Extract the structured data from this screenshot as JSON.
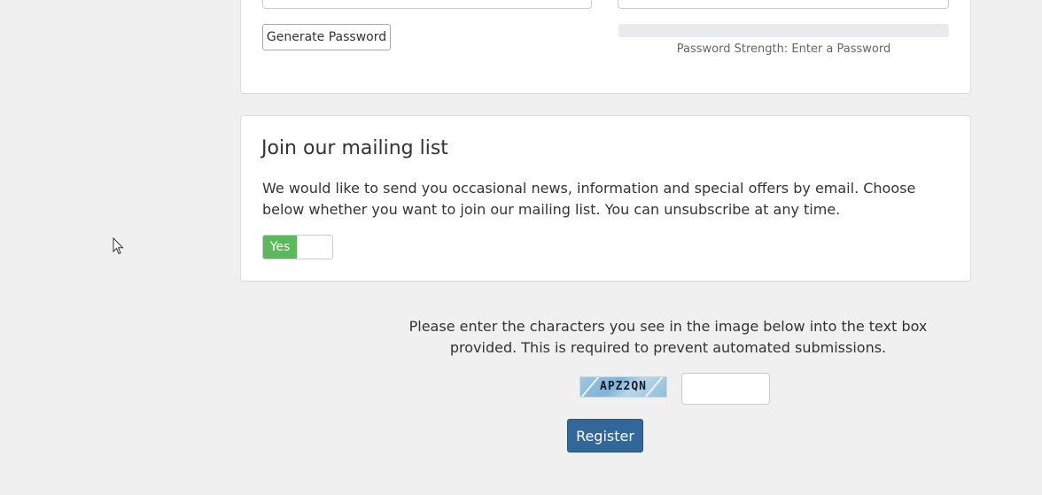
{
  "password_section": {
    "generate_button_label": "Generate Password",
    "strength_label": "Password Strength: Enter a Password"
  },
  "mailing_list": {
    "title": "Join our mailing list",
    "description": "We would like to send you occasional news, information and special offers by email. Choose below whether you want to join our mailing list. You can unsubscribe at any time.",
    "toggle_label": "Yes"
  },
  "captcha": {
    "instructions": "Please enter the characters you see in the image below into the text box provided. This is required to prevent automated submissions.",
    "image_text": "APZ2QN",
    "input_value": ""
  },
  "register_button_label": "Register",
  "colors": {
    "toggle_on": "#5cb85c",
    "primary_button": "#336699",
    "page_background": "#f0f0f0"
  }
}
